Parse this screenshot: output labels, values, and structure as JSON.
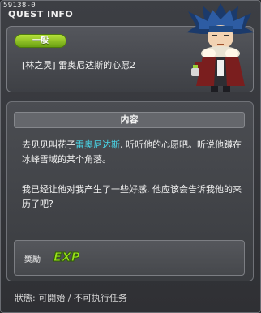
{
  "quest": {
    "id": "59138-0",
    "window_title": "QUEST INFO",
    "category": "一般",
    "title": "[林之灵] 雷奥尼达斯的心愿2"
  },
  "content": {
    "section_label": "内容",
    "desc_before": "去见见叫花子",
    "desc_highlight": "雷奥尼达斯",
    "desc_after": ", 听听他的心愿吧。听说他蹲在冰峰雪域的某个角落。",
    "desc_2": "我已经让他对我产生了一些好感, 他应该会告诉我他的来历了吧?"
  },
  "reward": {
    "label": "獎勵",
    "exp_text": "EXP"
  },
  "status": {
    "label": "狀態:",
    "value": "可開始 / 不可执行任务"
  },
  "colors": {
    "highlight": "#49d6e8",
    "badge_green": "#8cc624",
    "exp_green": "#9be31c"
  },
  "icons": [
    "npc-portrait-icon",
    "exp-icon"
  ]
}
